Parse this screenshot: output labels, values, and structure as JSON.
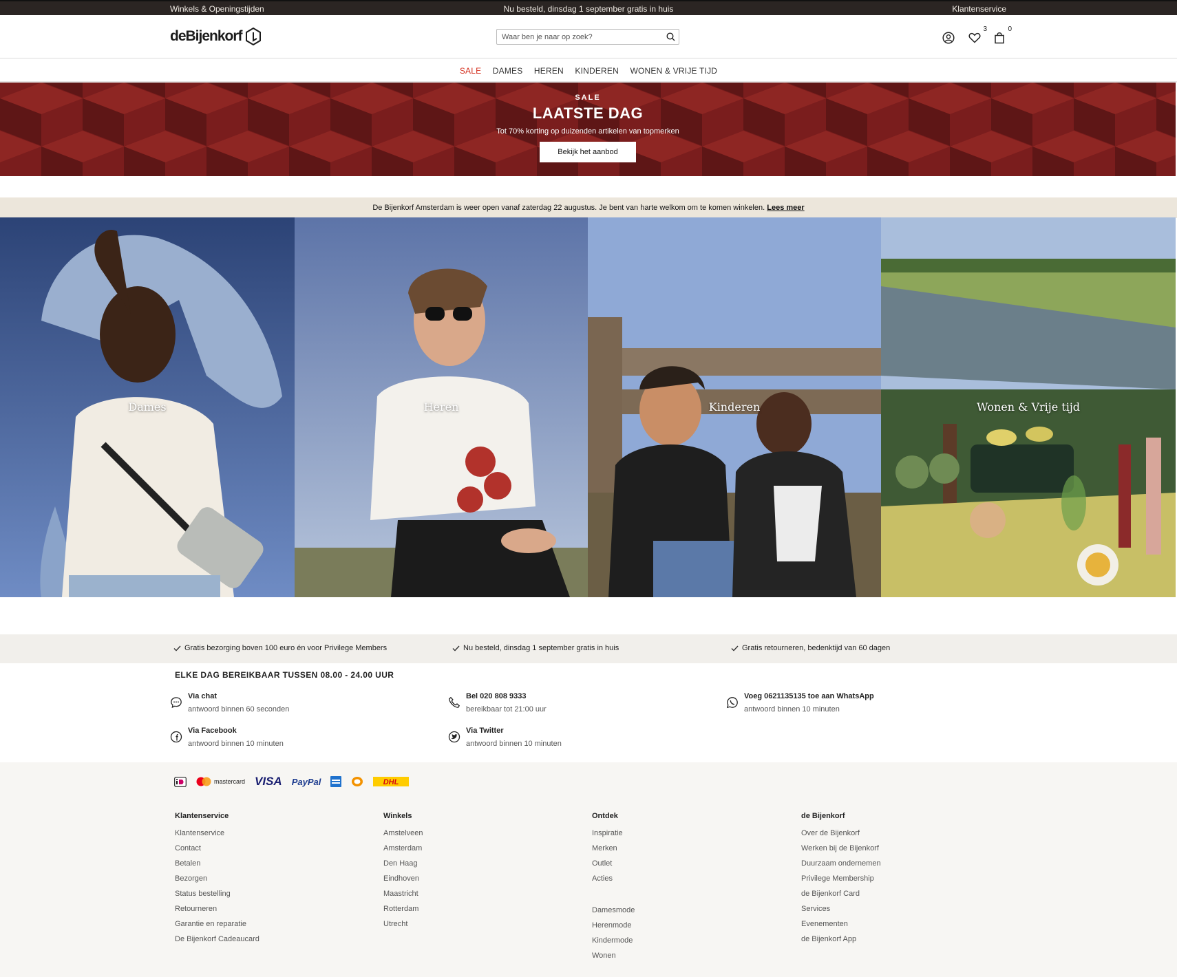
{
  "topbar": {
    "left": "Winkels & Openingstijden",
    "center": "Nu besteld, dinsdag 1 september gratis in huis",
    "right": "Klantenservice"
  },
  "header": {
    "logo_text": "deBijenkorf",
    "search_placeholder": "Waar ben je naar op zoek?",
    "favorites_count": "3",
    "cart_count": "0"
  },
  "nav": {
    "items": [
      "SALE",
      "DAMES",
      "HEREN",
      "KINDEREN",
      "WONEN & VRIJE TIJD"
    ]
  },
  "banner": {
    "kicker": "SALE",
    "title": "LAATSTE DAG",
    "subtitle": "Tot 70% korting op duizenden artikelen van topmerken",
    "button": "Bekijk het aanbod",
    "colors": {
      "base": "#7a1d1d",
      "light": "#8e2623",
      "dark": "#5e1616"
    }
  },
  "notice": {
    "text": "De Bijenkorf Amsterdam is weer open vanaf zaterdag 22 augustus. Je bent van harte welkom om te komen winkelen.",
    "link": "Lees meer"
  },
  "tiles": [
    {
      "label": "Dames"
    },
    {
      "label": "Heren"
    },
    {
      "label": "Kinderen"
    },
    {
      "label": "Wonen & Vrije tijd"
    }
  ],
  "usp": [
    "Gratis bezorging boven 100 euro én voor Privilege Members",
    "Nu besteld, dinsdag 1 september gratis in huis",
    "Gratis retourneren, bedenktijd van 60 dagen"
  ],
  "contact": {
    "title": "ELKE DAG BEREIKBAAR TUSSEN 08.00 - 24.00 UUR",
    "items": [
      {
        "title": "Via chat",
        "sub": "antwoord binnen 60 seconden",
        "icon": "chat-icon"
      },
      {
        "title": "Bel 020 808 9333",
        "sub": "bereikbaar tot 21:00 uur",
        "icon": "phone-icon"
      },
      {
        "title": "Voeg 0621135135 toe aan WhatsApp",
        "sub": "antwoord binnen 10 minuten",
        "icon": "whatsapp-icon"
      },
      {
        "title": "Via Facebook",
        "sub": "antwoord binnen 10 minuten",
        "icon": "facebook-icon"
      },
      {
        "title": "Via Twitter",
        "sub": "antwoord binnen 10 minuten",
        "icon": "twitter-icon"
      }
    ]
  },
  "payments": [
    "iDEAL",
    "mastercard",
    "VISA",
    "PayPal",
    "American Express",
    "Postnl",
    "DHL"
  ],
  "footer": {
    "columns": [
      {
        "title": "Klantenservice",
        "links": [
          "Klantenservice",
          "Contact",
          "Betalen",
          "Bezorgen",
          "Status bestelling",
          "Retourneren",
          "Garantie en reparatie",
          "De Bijenkorf Cadeaucard"
        ]
      },
      {
        "title": "Winkels",
        "links": [
          "Amstelveen",
          "Amsterdam",
          "Den Haag",
          "Eindhoven",
          "Maastricht",
          "Rotterdam",
          "Utrecht"
        ]
      },
      {
        "title": "Ontdek",
        "links": [
          "Inspiratie",
          "Merken",
          "Outlet",
          "Acties"
        ],
        "links2": [
          "Damesmode",
          "Herenmode",
          "Kindermode",
          "Wonen"
        ]
      },
      {
        "title": "de Bijenkorf",
        "links": [
          "Over de Bijenkorf",
          "Werken bij de Bijenkorf",
          "Duurzaam ondernemen",
          "Privilege Membership",
          "de Bijenkorf Card",
          "Services",
          "Evenementen",
          "de Bijenkorf App"
        ]
      }
    ]
  }
}
